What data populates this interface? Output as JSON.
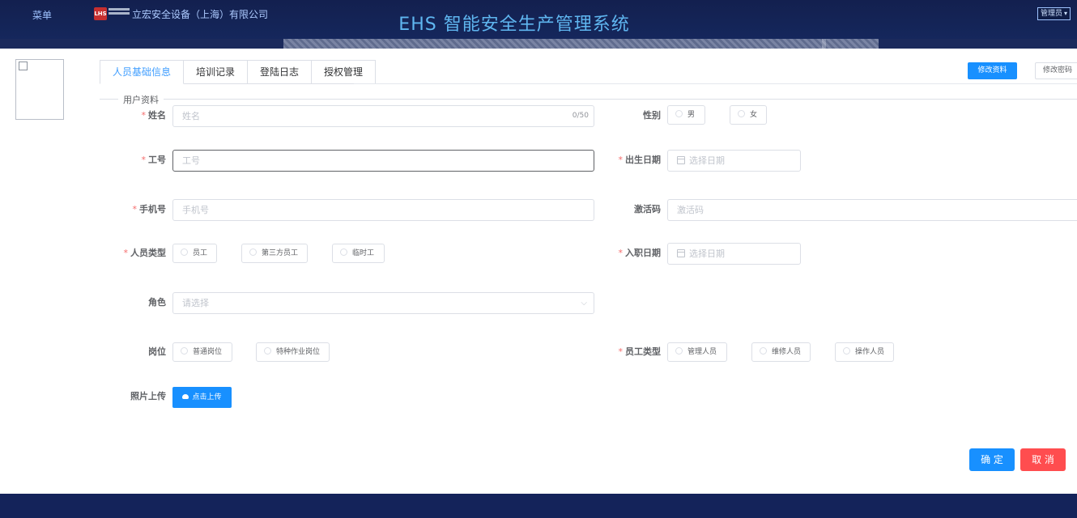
{
  "header": {
    "menu_label": "菜单",
    "logo_text": "LHS",
    "company_name": "立宏安全设备（上海）有限公司",
    "system_title": "EHS 智能安全生产管理系统",
    "user_role": "管理员"
  },
  "tabs": [
    {
      "label": "人员基础信息",
      "active": true
    },
    {
      "label": "培训记录",
      "active": false
    },
    {
      "label": "登陆日志",
      "active": false
    },
    {
      "label": "授权管理",
      "active": false
    }
  ],
  "actions": {
    "edit_profile": "修改资料",
    "change_password": "修改密码"
  },
  "section_title": "用户资料",
  "form": {
    "name": {
      "label": "姓名",
      "required": true,
      "placeholder": "姓名",
      "counter": "0/50"
    },
    "gender": {
      "label": "性别",
      "options": [
        "男",
        "女"
      ]
    },
    "employee_id": {
      "label": "工号",
      "required": true,
      "placeholder": "工号"
    },
    "birth_date": {
      "label": "出生日期",
      "required": true,
      "placeholder": "选择日期"
    },
    "phone": {
      "label": "手机号",
      "required": true,
      "placeholder": "手机号"
    },
    "activation_code": {
      "label": "激活码",
      "placeholder": "激活码"
    },
    "person_type": {
      "label": "人员类型",
      "required": true,
      "options": [
        "员工",
        "第三方员工",
        "临时工"
      ]
    },
    "hire_date": {
      "label": "入职日期",
      "required": true,
      "placeholder": "选择日期"
    },
    "role": {
      "label": "角色",
      "placeholder": "请选择"
    },
    "position": {
      "label": "岗位",
      "options": [
        "普通岗位",
        "特种作业岗位"
      ]
    },
    "staff_type": {
      "label": "员工类型",
      "required": true,
      "options": [
        "管理人员",
        "维修人员",
        "操作人员"
      ]
    },
    "photo": {
      "label": "照片上传",
      "button": "点击上传"
    }
  },
  "footer_buttons": {
    "confirm": "确 定",
    "cancel": "取 消"
  },
  "colors": {
    "primary": "#1890ff",
    "danger": "#ff4d4f",
    "header_bg": "#13204f",
    "title": "#5fb6f0",
    "required": "#f56c6c"
  }
}
